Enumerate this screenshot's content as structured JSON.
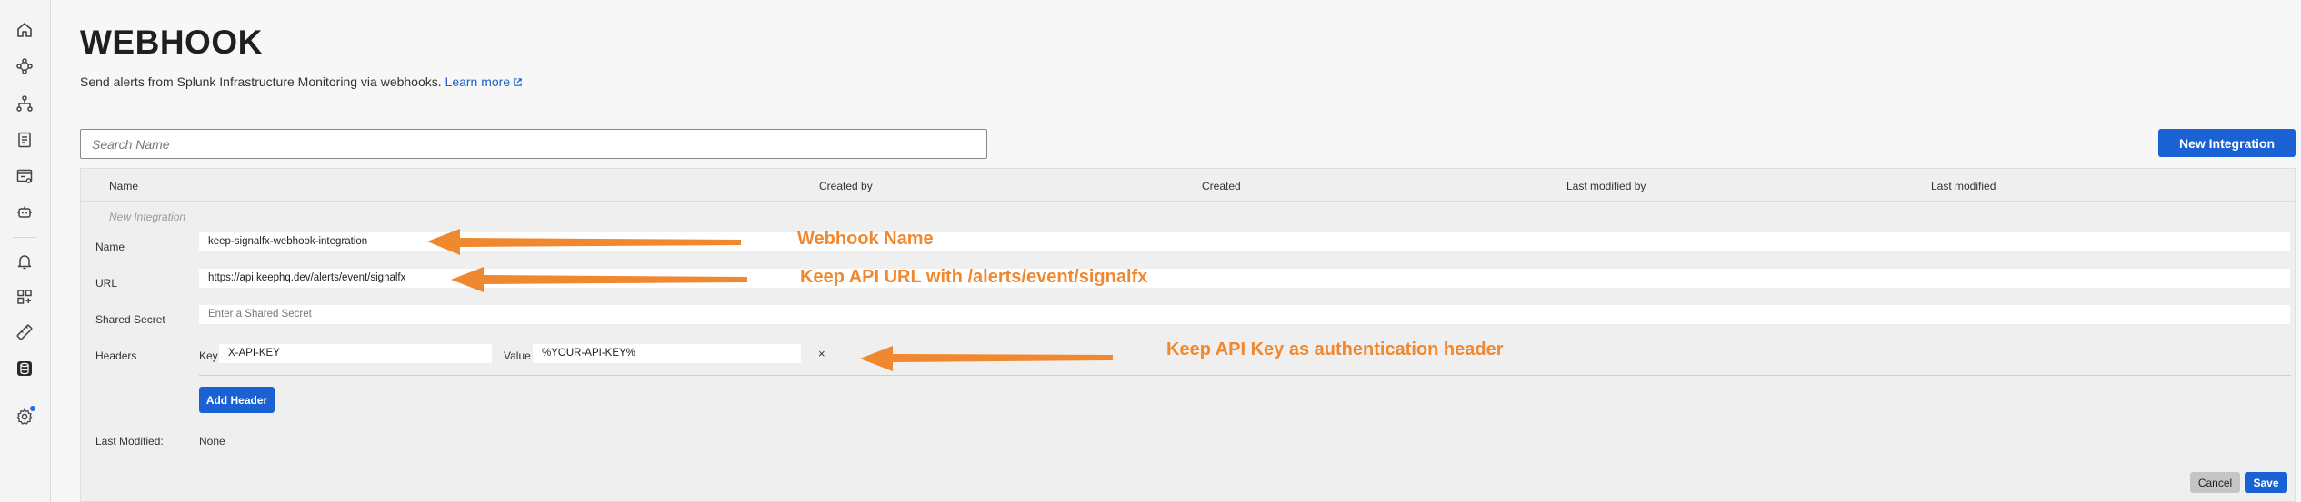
{
  "sidebar": {
    "icons": [
      "home-icon",
      "topology-icon",
      "hierarchy-icon",
      "logs-icon",
      "dashboard-monitor-icon",
      "robot-icon",
      "bell-icon",
      "grid-icon",
      "ruler-icon",
      "database-icon",
      "gear-icon"
    ]
  },
  "page": {
    "title": "WEBHOOK",
    "subtitle": "Send alerts from Splunk Infrastructure Monitoring via webhooks.",
    "learn_more": "Learn more"
  },
  "search": {
    "placeholder": "Search Name",
    "value": ""
  },
  "new_integration_button": "New Integration",
  "table": {
    "columns": [
      "Name",
      "Created by",
      "Created",
      "Last modified by",
      "Last modified"
    ]
  },
  "form": {
    "new_integration_label": "New Integration",
    "name_label": "Name",
    "name_value": "keep-signalfx-webhook-integration",
    "url_label": "URL",
    "url_value": "https://api.keephq.dev/alerts/event/signalfx",
    "secret_label": "Shared Secret",
    "secret_placeholder": "Enter a Shared Secret",
    "headers_label": "Headers",
    "key_label": "Key",
    "key_value": "X-API-KEY",
    "value_label": "Value",
    "value_value": "%YOUR-API-KEY%",
    "remove_glyph": "×",
    "add_header": "Add Header",
    "last_modified_label": "Last Modified:",
    "last_modified_value": "None",
    "cancel": "Cancel",
    "save": "Save"
  },
  "annotations": {
    "name": "Webhook Name",
    "url": "Keep API URL with /alerts/event/signalfx",
    "header": "Keep API Key as authentication header"
  },
  "colors": {
    "accent": "#1a62d3",
    "annotation": "#f0882f",
    "link": "#1a5fc7"
  }
}
